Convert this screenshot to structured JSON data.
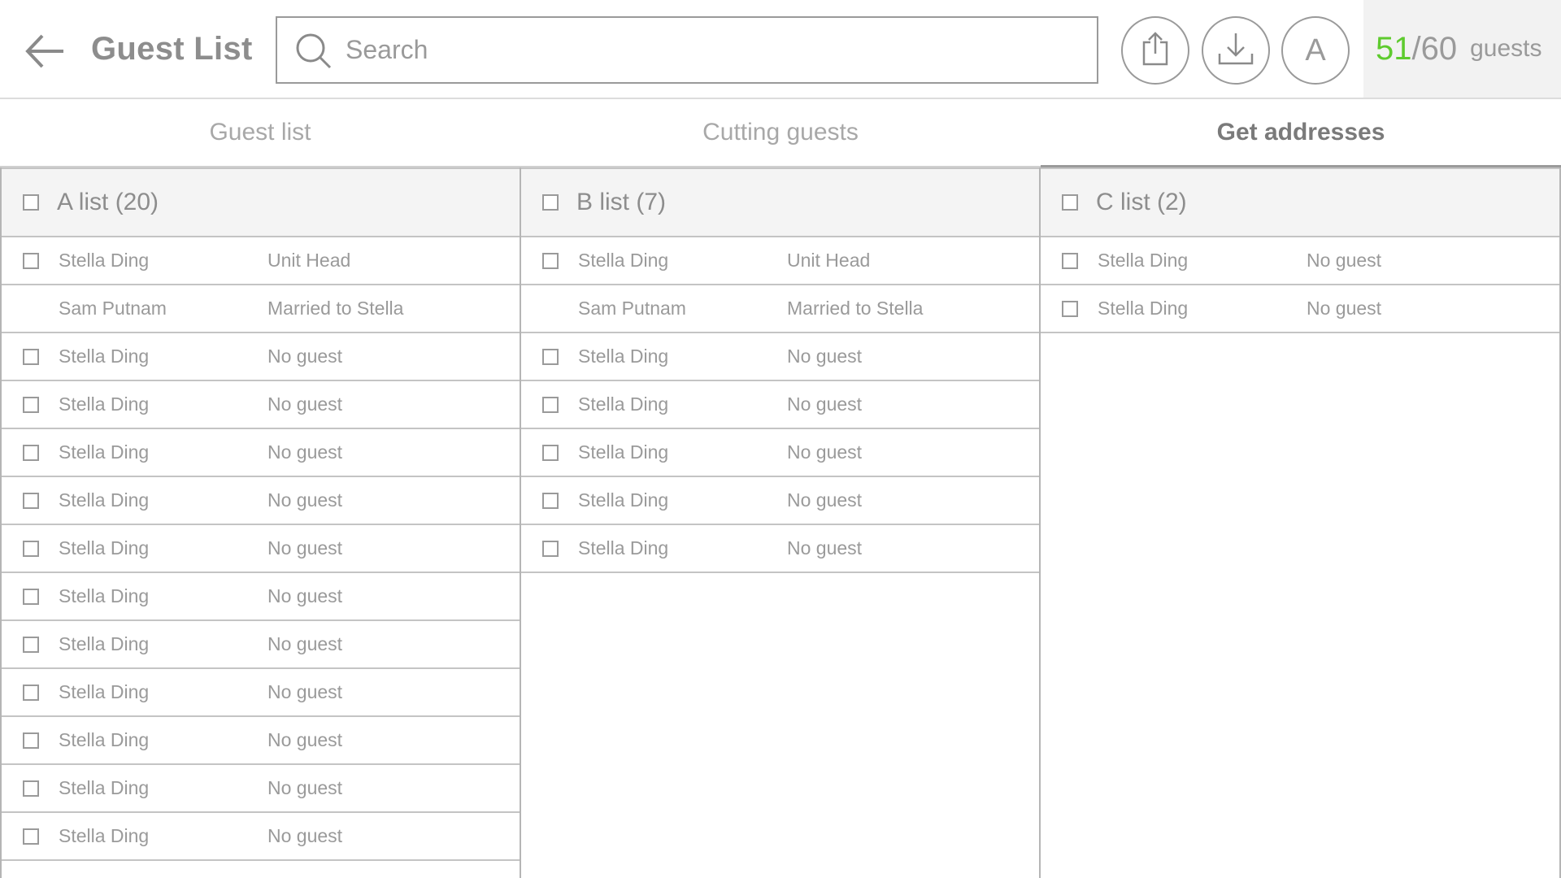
{
  "header": {
    "title": "Guest List",
    "search_placeholder": "Search",
    "avatar_letter": "A",
    "guest_count_current": "51",
    "guest_count_separator": "/",
    "guest_count_total": "60",
    "guest_count_label": "guests",
    "accent_color": "#5ecb2e"
  },
  "tabs": [
    {
      "label": "Guest list"
    },
    {
      "label": "Cutting guests"
    },
    {
      "label": "Get addresses",
      "active": true
    }
  ],
  "lists": {
    "a": {
      "title": "A list (20)",
      "rows": [
        {
          "name": "Stella Ding",
          "note": "Unit Head"
        },
        {
          "name": "Sam Putnam",
          "note": "Married to Stella"
        },
        {
          "name": "Stella Ding",
          "note": "No guest"
        },
        {
          "name": "Stella Ding",
          "note": "No guest"
        },
        {
          "name": "Stella Ding",
          "note": "No guest"
        },
        {
          "name": "Stella Ding",
          "note": "No guest"
        },
        {
          "name": "Stella Ding",
          "note": "No guest"
        },
        {
          "name": "Stella Ding",
          "note": "No guest"
        },
        {
          "name": "Stella Ding",
          "note": "No guest"
        },
        {
          "name": "Stella Ding",
          "note": "No guest"
        },
        {
          "name": "Stella Ding",
          "note": "No guest"
        },
        {
          "name": "Stella Ding",
          "note": "No guest"
        },
        {
          "name": "Stella Ding",
          "note": "No guest"
        }
      ]
    },
    "b": {
      "title": "B list (7)",
      "rows": [
        {
          "name": "Stella Ding",
          "note": "Unit Head"
        },
        {
          "name": "Sam Putnam",
          "note": "Married to Stella"
        },
        {
          "name": "Stella Ding",
          "note": "No guest"
        },
        {
          "name": "Stella Ding",
          "note": "No guest"
        },
        {
          "name": "Stella Ding",
          "note": "No guest"
        },
        {
          "name": "Stella Ding",
          "note": "No guest"
        },
        {
          "name": "Stella Ding",
          "note": "No guest"
        }
      ]
    },
    "c": {
      "title": "C list (2)",
      "rows": [
        {
          "name": "Stella Ding",
          "note": "No guest"
        },
        {
          "name": "Stella Ding",
          "note": "No guest"
        }
      ]
    }
  }
}
